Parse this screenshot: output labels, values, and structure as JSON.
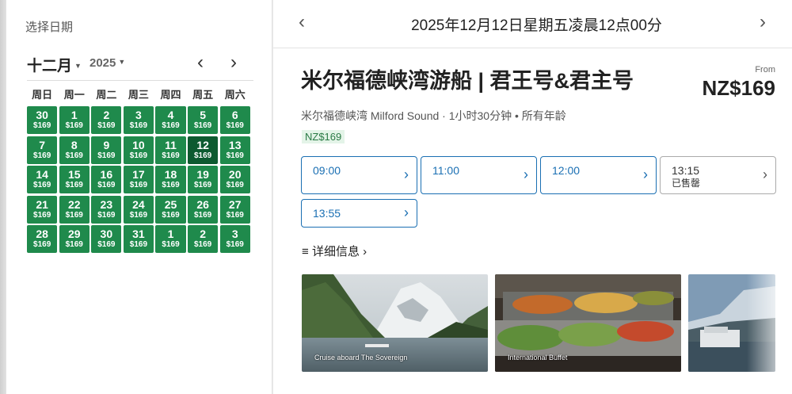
{
  "left_panel": {
    "title": "选择日期",
    "month": "十二月",
    "year": "2025",
    "weekdays": [
      "周日",
      "周一",
      "周二",
      "周三",
      "周四",
      "周五",
      "周六"
    ],
    "price": "$169",
    "days": [
      "30",
      "1",
      "2",
      "3",
      "4",
      "5",
      "6",
      "7",
      "8",
      "9",
      "10",
      "11",
      "12",
      "13",
      "14",
      "15",
      "16",
      "17",
      "18",
      "19",
      "20",
      "21",
      "22",
      "23",
      "24",
      "25",
      "26",
      "27",
      "28",
      "29",
      "30",
      "31",
      "1",
      "2",
      "3"
    ],
    "selected_day": "12"
  },
  "top_bar": {
    "date_text": "2025年12月12日星期五凌晨12点00分",
    "prev": "‹",
    "next": "›"
  },
  "tour": {
    "title": "米尔福德峡湾游船 | 君王号&君主号",
    "from_label": "From",
    "price": "NZ$169",
    "subinfo": "米尔福德峡湾 Milford Sound · 1小时30分钟 • 所有年龄",
    "price_tag": "NZ$169",
    "details_label": "详细信息"
  },
  "slots": [
    {
      "time": "09:00",
      "status": ""
    },
    {
      "time": "11:00",
      "status": ""
    },
    {
      "time": "12:00",
      "status": ""
    },
    {
      "time": "13:15",
      "status": "已售罄"
    },
    {
      "time": "13:55",
      "status": ""
    }
  ],
  "photos": [
    {
      "caption": "Cruise aboard The Sovereign"
    },
    {
      "caption": "International Buffet"
    },
    {
      "caption": ""
    }
  ],
  "colors": {
    "calendar_green": "#1f8a4c",
    "selected_green": "#0d5a30",
    "slot_blue": "#1a6fb3",
    "price_tag_bg": "#e4f4e8"
  }
}
